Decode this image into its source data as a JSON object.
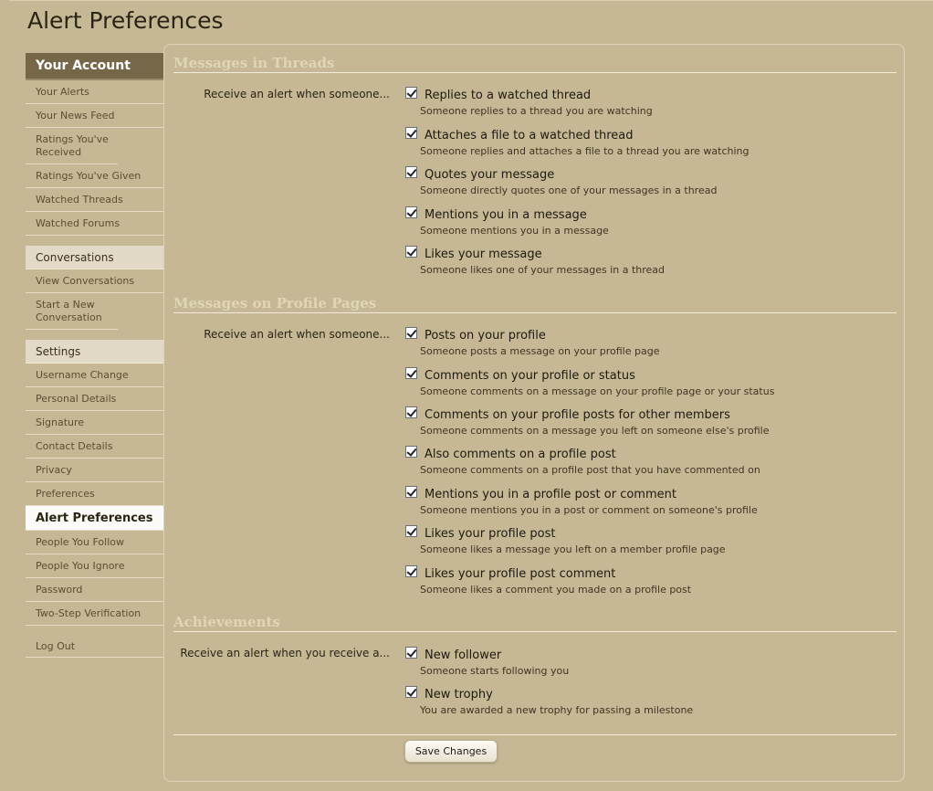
{
  "page": {
    "title": "Alert Preferences"
  },
  "sidebar": {
    "header": "Your Account",
    "account_items": [
      "Your Alerts",
      "Your News Feed",
      "Ratings You've Received",
      "Ratings You've Given",
      "Watched Threads",
      "Watched Forums"
    ],
    "conversations_header": "Conversations",
    "conversation_items": [
      "View Conversations",
      "Start a New Conversation"
    ],
    "settings_header": "Settings",
    "settings_items": [
      "Username Change",
      "Personal Details",
      "Signature",
      "Contact Details",
      "Privacy",
      "Preferences"
    ],
    "active_item": "Alert Preferences",
    "settings_items_after": [
      "People You Follow",
      "People You Ignore",
      "Password",
      "Two-Step Verification"
    ],
    "logout": "Log Out"
  },
  "sections": [
    {
      "title": "Messages in Threads",
      "label": "Receive an alert when someone...",
      "options": [
        {
          "title": "Replies to a watched thread",
          "desc": "Someone replies to a thread you are watching",
          "checked": true
        },
        {
          "title": "Attaches a file to a watched thread",
          "desc": "Someone replies and attaches a file to a thread you are watching",
          "checked": true
        },
        {
          "title": "Quotes your message",
          "desc": "Someone directly quotes one of your messages in a thread",
          "checked": true
        },
        {
          "title": "Mentions you in a message",
          "desc": "Someone mentions you in a message",
          "checked": true
        },
        {
          "title": "Likes your message",
          "desc": "Someone likes one of your messages in a thread",
          "checked": true
        }
      ]
    },
    {
      "title": "Messages on Profile Pages",
      "label": "Receive an alert when someone...",
      "options": [
        {
          "title": "Posts on your profile",
          "desc": "Someone posts a message on your profile page",
          "checked": true
        },
        {
          "title": "Comments on your profile or status",
          "desc": "Someone comments on a message on your profile page or your status",
          "checked": true
        },
        {
          "title": "Comments on your profile posts for other members",
          "desc": "Someone comments on a message you left on someone else's profile",
          "checked": true
        },
        {
          "title": "Also comments on a profile post",
          "desc": "Someone comments on a profile post that you have commented on",
          "checked": true
        },
        {
          "title": "Mentions you in a profile post or comment",
          "desc": "Someone mentions you in a post or comment on someone's profile",
          "checked": true
        },
        {
          "title": "Likes your profile post",
          "desc": "Someone likes a message you left on a member profile page",
          "checked": true
        },
        {
          "title": "Likes your profile post comment",
          "desc": "Someone likes a comment you made on a profile post",
          "checked": true
        }
      ]
    },
    {
      "title": "Achievements",
      "label": "Receive an alert when you receive a...",
      "options": [
        {
          "title": "New follower",
          "desc": "Someone starts following you",
          "checked": true
        },
        {
          "title": "New trophy",
          "desc": "You are awarded a new trophy for passing a milestone",
          "checked": true
        }
      ]
    }
  ],
  "save_label": "Save Changes"
}
